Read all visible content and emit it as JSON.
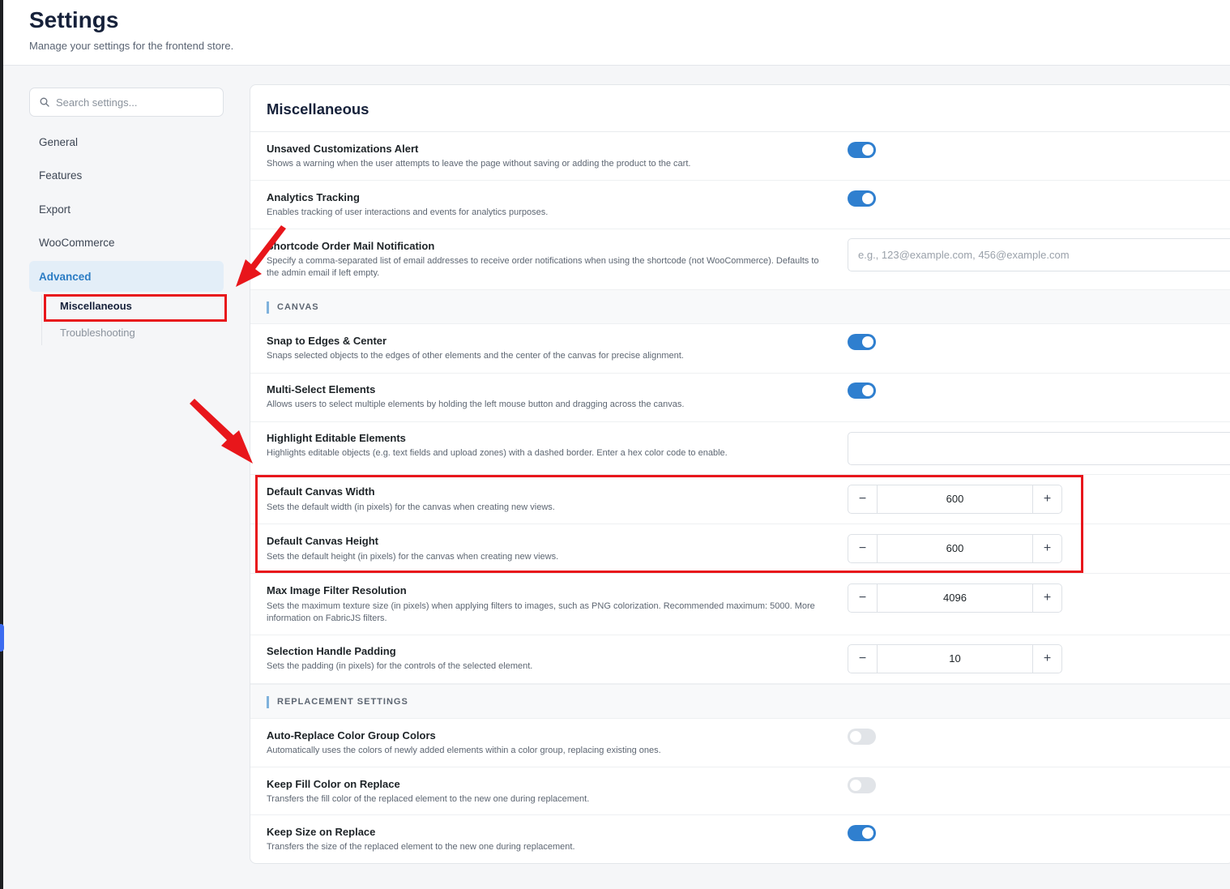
{
  "header": {
    "title": "Settings",
    "subtitle": "Manage your settings for the frontend store."
  },
  "sidebar": {
    "search_placeholder": "Search settings...",
    "items": [
      {
        "label": "General"
      },
      {
        "label": "Features"
      },
      {
        "label": "Export"
      },
      {
        "label": "WooCommerce"
      },
      {
        "label": "Advanced",
        "active": true
      }
    ],
    "subitems": [
      {
        "label": "Miscellaneous",
        "active": true
      },
      {
        "label": "Troubleshooting"
      }
    ]
  },
  "main": {
    "title": "Miscellaneous",
    "settings": {
      "unsaved": {
        "label": "Unsaved Customizations Alert",
        "desc": "Shows a warning when the user attempts to leave the page without saving or adding the product to the cart.",
        "enabled": true
      },
      "analytics": {
        "label": "Analytics Tracking",
        "desc": "Enables tracking of user interactions and events for analytics purposes.",
        "enabled": true
      },
      "shortcode_mail": {
        "label": "Shortcode Order Mail Notification",
        "desc": "Specify a comma-separated list of email addresses to receive order notifications when using the shortcode (not WooCommerce). Defaults to the admin email if left empty.",
        "placeholder": "e.g., 123@example.com, 456@example.com",
        "value": ""
      }
    },
    "canvas_section": {
      "heading": "CANVAS",
      "snap": {
        "label": "Snap to Edges & Center",
        "desc": "Snaps selected objects to the edges of other elements and the center of the canvas for precise alignment.",
        "enabled": true
      },
      "multiselect": {
        "label": "Multi-Select Elements",
        "desc": "Allows users to select multiple elements by holding the left mouse button and dragging across the canvas.",
        "enabled": true
      },
      "highlight": {
        "label": "Highlight Editable Elements",
        "desc": "Highlights editable objects (e.g. text fields and upload zones) with a dashed border. Enter a hex color code to enable.",
        "value": ""
      },
      "width": {
        "label": "Default Canvas Width",
        "desc": "Sets the default width (in pixels) for the canvas when creating new views.",
        "value": "600"
      },
      "height": {
        "label": "Default Canvas Height",
        "desc": "Sets the default height (in pixels) for the canvas when creating new views.",
        "value": "600"
      },
      "max_filter": {
        "label": "Max Image Filter Resolution",
        "desc": "Sets the maximum texture size (in pixels) when applying filters to images, such as PNG colorization. Recommended maximum: 5000. More information on FabricJS filters.",
        "value": "4096"
      },
      "handle_padding": {
        "label": "Selection Handle Padding",
        "desc": "Sets the padding (in pixels) for the controls of the selected element.",
        "value": "10"
      }
    },
    "replacement_section": {
      "heading": "REPLACEMENT SETTINGS",
      "auto_replace": {
        "label": "Auto-Replace Color Group Colors",
        "desc": "Automatically uses the colors of newly added elements within a color group, replacing existing ones.",
        "enabled": false
      },
      "keep_fill": {
        "label": "Keep Fill Color on Replace",
        "desc": "Transfers the fill color of the replaced element to the new one during replacement.",
        "enabled": false
      },
      "keep_size": {
        "label": "Keep Size on Replace",
        "desc": "Transfers the size of the replaced element to the new one during replacement.",
        "enabled": true
      }
    },
    "stepper_minus": "−",
    "stepper_plus": "+"
  },
  "colors": {
    "accent": "#2f7fcf",
    "annotation": "#e8161b"
  }
}
